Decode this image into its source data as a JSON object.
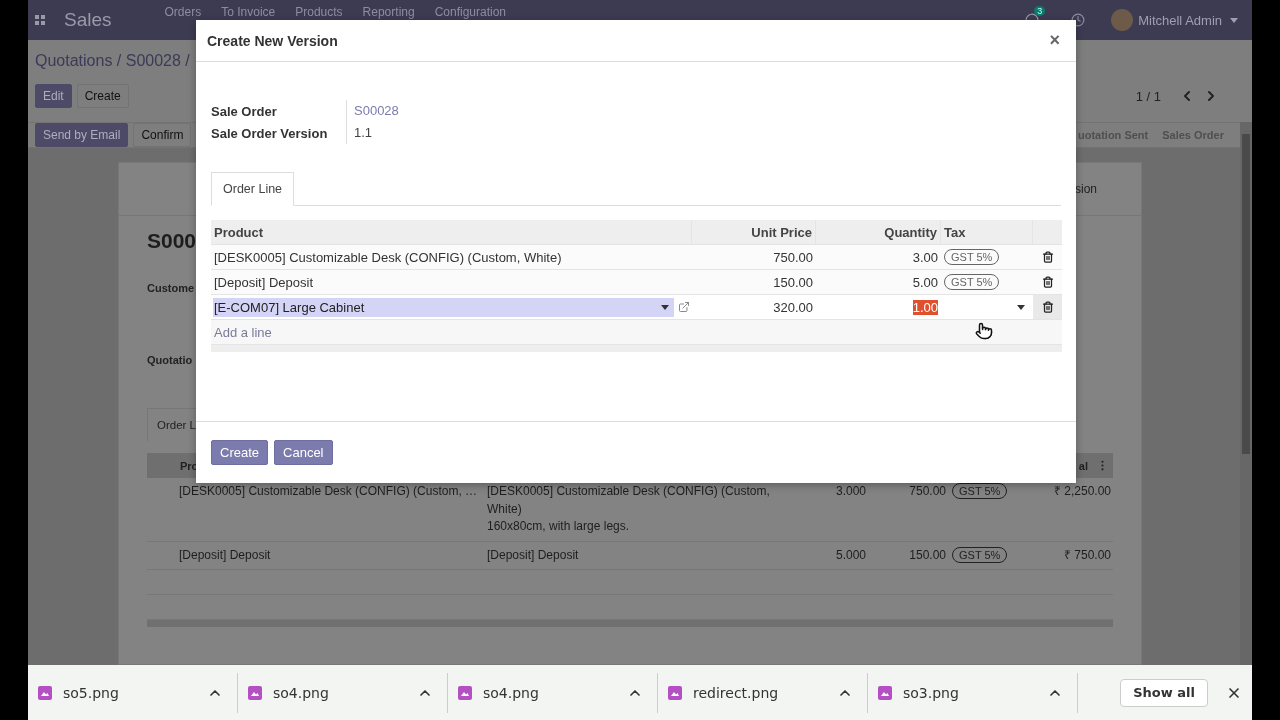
{
  "navbar": {
    "app": "Sales",
    "menu": [
      "Orders",
      "To Invoice",
      "Products",
      "Reporting",
      "Configuration"
    ],
    "message_count": "3",
    "user": "Mitchell Admin"
  },
  "breadcrumb": "Quotations / S00028 /",
  "toolbar": [
    {
      "label": "Edit",
      "primary": true
    },
    {
      "label": "Create",
      "primary": false
    }
  ],
  "pager": "1 / 1",
  "actions": [
    {
      "label": "Send by Email",
      "primary": true
    },
    {
      "label": "Confirm",
      "primary": false
    }
  ],
  "stages": [
    "uotation Sent",
    "Sales Order"
  ],
  "sheet": {
    "smart_button": "sion",
    "title": "S000",
    "labels": [
      "Custome",
      "Quotatio"
    ],
    "tab": "Order L",
    "table": {
      "columns": [
        "Pro",
        "al"
      ],
      "rows": [
        {
          "product": "[DESK0005] Customizable Desk (CONFIG) (Custom, …",
          "description": [
            "[DESK0005] Customizable Desk (CONFIG) (Custom, White)",
            "160x80cm, with large legs."
          ],
          "quantity": "3.000",
          "price": "750.00",
          "tax": "GST 5%",
          "total": "₹ 2,250.00"
        },
        {
          "product": "[Deposit] Deposit",
          "description": [
            "[Deposit] Deposit"
          ],
          "quantity": "5.000",
          "price": "150.00",
          "tax": "GST 5%",
          "total": "₹ 750.00"
        }
      ]
    }
  },
  "dialog": {
    "title": "Create New Version",
    "close": "×",
    "fields": [
      {
        "label": "Sale Order",
        "value": "S00028",
        "link": true
      },
      {
        "label": "Sale Order Version",
        "value": "1.1",
        "link": false
      }
    ],
    "tabs": [
      {
        "label": "Order Line",
        "selected": true
      }
    ],
    "columns": [
      "Product",
      "Unit Price",
      "Quantity",
      "Tax"
    ],
    "lines": [
      {
        "product": "[DESK0005] Customizable Desk (CONFIG) (Custom, White)",
        "unit_price": "750.00",
        "quantity": "3.00",
        "taxes": [
          "GST 5%"
        ],
        "editing": false
      },
      {
        "product": "[Deposit] Deposit",
        "unit_price": "150.00",
        "quantity": "5.00",
        "taxes": [
          "GST 5%"
        ],
        "editing": false
      },
      {
        "product": "[E-COM07] Large Cabinet",
        "unit_price": "320.00",
        "quantity": "1.00",
        "editing": true
      }
    ],
    "add_line": "Add a line",
    "buttons": [
      "Create",
      "Cancel"
    ]
  },
  "downloads": {
    "files": [
      "so5.png",
      "so4.png",
      "so4.png",
      "redirect.png",
      "so3.png"
    ],
    "show_all": "Show all"
  }
}
